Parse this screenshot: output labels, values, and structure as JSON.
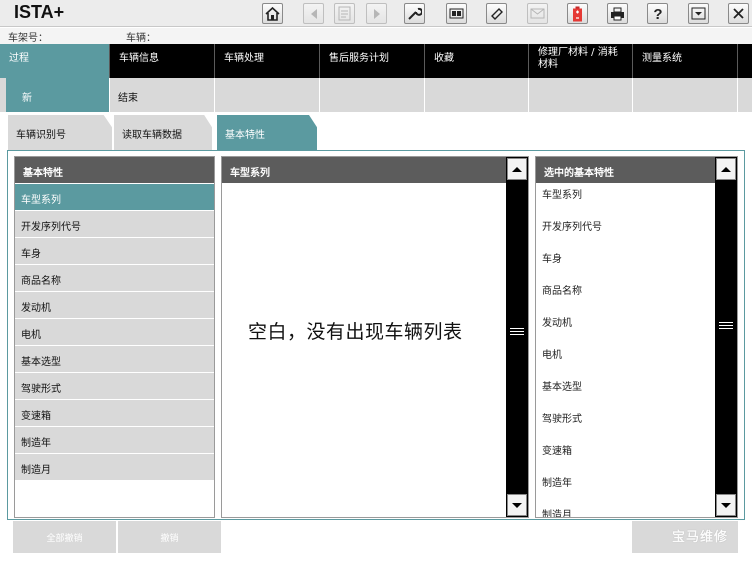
{
  "app": {
    "title": "ISTA+"
  },
  "toolbar": {
    "buttons": [
      {
        "icon": "home-icon",
        "enabled": true
      },
      {
        "icon": "back-arrow-icon",
        "enabled": false
      },
      {
        "icon": "document-icon",
        "enabled": false
      },
      {
        "icon": "forward-arrow-icon",
        "enabled": false
      },
      {
        "icon": "wrench-icon",
        "enabled": true
      },
      {
        "icon": "vehicle-interface-icon",
        "enabled": true
      },
      {
        "icon": "eraser-icon",
        "enabled": true
      },
      {
        "icon": "mail-icon",
        "enabled": false
      },
      {
        "icon": "battery-icon",
        "enabled": true
      },
      {
        "icon": "print-icon",
        "enabled": true
      },
      {
        "icon": "help-icon",
        "enabled": true
      },
      {
        "icon": "minimize-icon",
        "enabled": true
      },
      {
        "icon": "close-icon",
        "enabled": true
      }
    ]
  },
  "info": {
    "vin_label": "车架号：",
    "vehicle_label": "车辆："
  },
  "main_nav": {
    "items": [
      "过程",
      "车辆信息",
      "车辆处理",
      "售后服务计划",
      "收藏",
      "修理厂材料 / 消耗材料",
      "测量系统"
    ],
    "active_index": 0
  },
  "sub_nav": {
    "items": [
      "新",
      "结束"
    ],
    "active_index": 0
  },
  "tabs": {
    "items": [
      "车辆识别号",
      "读取车辆数据",
      "基本特性"
    ],
    "active_index": 2
  },
  "left_panel": {
    "header": "基本特性",
    "items": [
      "车型系列",
      "开发序列代号",
      "车身",
      "商品名称",
      "发动机",
      "电机",
      "基本选型",
      "驾驶形式",
      "变速箱",
      "制造年",
      "制造月"
    ],
    "selected_index": 0
  },
  "middle_panel": {
    "header": "车型系列",
    "annotation": "空白，没有出现车辆列表"
  },
  "right_panel": {
    "header": "选中的基本特性",
    "items": [
      "车型系列",
      "开发序列代号",
      "车身",
      "商品名称",
      "发动机",
      "电机",
      "基本选型",
      "驾驶形式",
      "变速箱",
      "制造年",
      "制造月"
    ]
  },
  "bottom": {
    "cancel_all_label": "全部撤销",
    "undo_label": "撤销",
    "watermark": "宝马维修"
  },
  "colors": {
    "accent": "#5b9aa0",
    "nav_bg": "#000000",
    "subnav_bg": "#d9d9d9",
    "header_bg": "#5c5c5c"
  }
}
